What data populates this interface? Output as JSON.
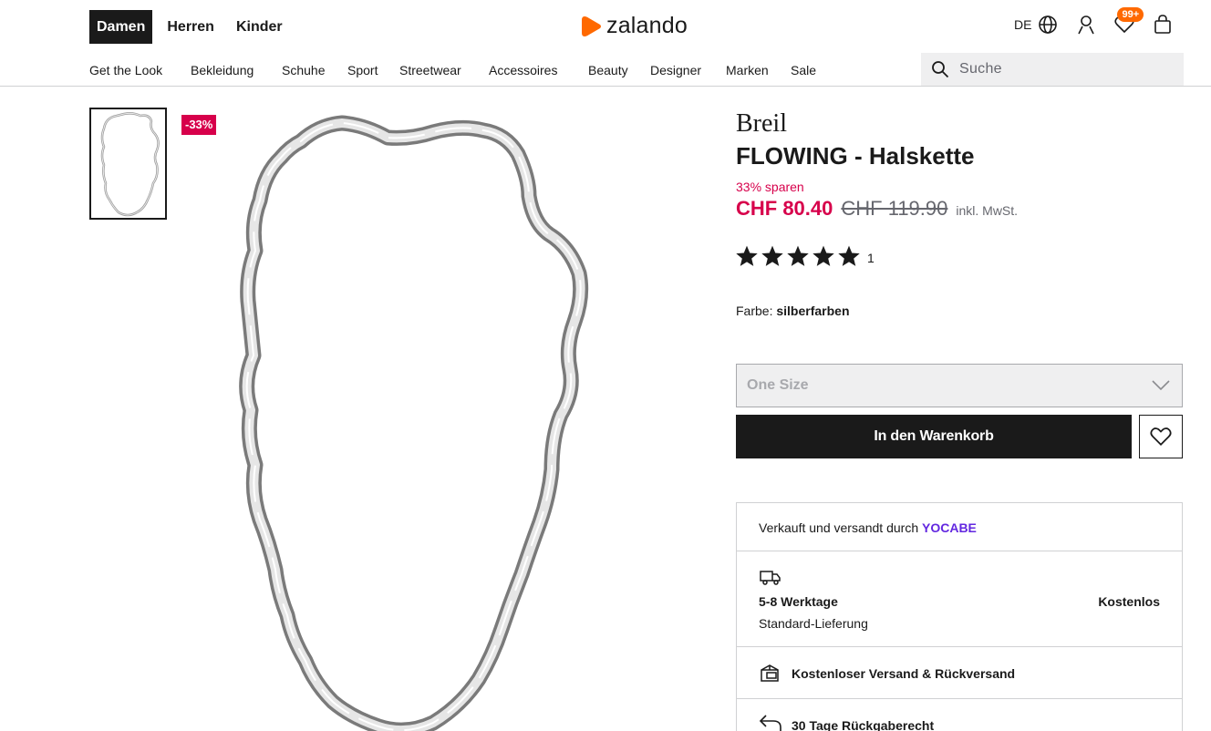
{
  "header": {
    "gender_tabs": [
      {
        "label": "Damen",
        "active": true
      },
      {
        "label": "Herren",
        "active": false
      },
      {
        "label": "Kinder",
        "active": false
      }
    ],
    "logo_text": "zalando",
    "language": "DE",
    "wishlist_badge": "99+",
    "icons": [
      "globe-icon",
      "user-icon",
      "heart-icon",
      "shopping-bag-icon"
    ],
    "categories": [
      "Get the Look",
      "Bekleidung",
      "Schuhe",
      "Sport",
      "Streetwear",
      "Accessoires",
      "Beauty",
      "Designer",
      "Marken",
      "Sale"
    ],
    "search": {
      "placeholder": "Suche"
    }
  },
  "gallery": {
    "discount_badge": "-33%"
  },
  "product": {
    "brand": "Breil",
    "name": "FLOWING - Halskette",
    "savings": "33% sparen",
    "price_current": "CHF 80.40",
    "price_original": "CHF 119.90",
    "price_note": "inkl. MwSt.",
    "rating": 5,
    "rating_count": "1",
    "color_label": "Farbe:",
    "color_value": "silberfarben",
    "size_value": "One Size",
    "cart_button": "In den Warenkorb"
  },
  "delivery": {
    "seller_prefix": "Verkauft und versandt durch",
    "seller_name": "YOCABE",
    "shipping_days": "5-8 Werktage",
    "shipping_cost": "Kostenlos",
    "shipping_type": "Standard-Lieferung",
    "free_returns": "Kostenloser Versand & Rückversand",
    "return_period": "30 Tage Rückgaberecht"
  },
  "colors": {
    "sale_red": "#d7004b",
    "brand_orange": "#ff6900",
    "seller_purple": "#6328e0",
    "dark": "#1a1a1a"
  }
}
